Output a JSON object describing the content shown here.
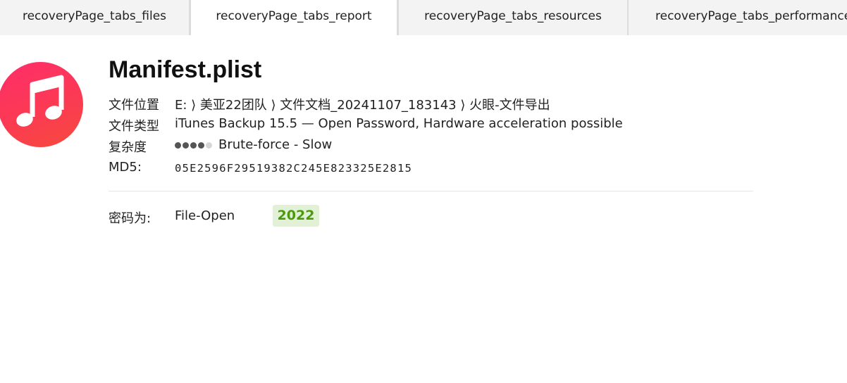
{
  "tabs": [
    {
      "label": "recoveryPage_tabs_files",
      "active": false
    },
    {
      "label": "recoveryPage_tabs_report",
      "active": true
    },
    {
      "label": "recoveryPage_tabs_resources",
      "active": false
    },
    {
      "label": "recoveryPage_tabs_performance",
      "active": false
    }
  ],
  "file": {
    "icon": "music-note-icon",
    "icon_colors": [
      "#ff2d6a",
      "#f74a3d"
    ],
    "name": "Manifest.plist",
    "location_label": "文件位置",
    "location_value": "E: ⟩ 美亚22团队 ⟩ 文件文档_20241107_183143 ⟩ 火眼-文件导出",
    "type_label": "文件类型",
    "type_value": "iTunes Backup 15.5 — Open Password, Hardware acceleration possible",
    "complexity_label": "复杂度",
    "complexity_level": 4,
    "complexity_max": 5,
    "complexity_value": "Brute-force - Slow",
    "md5_label": "MD5:",
    "md5_value": "05E2596F29519382C245E823325E2815"
  },
  "password": {
    "label": "密码为:",
    "type": "File-Open",
    "value": "2022",
    "badge_bg": "#e2f0d6",
    "badge_color": "#4a9a0e"
  }
}
